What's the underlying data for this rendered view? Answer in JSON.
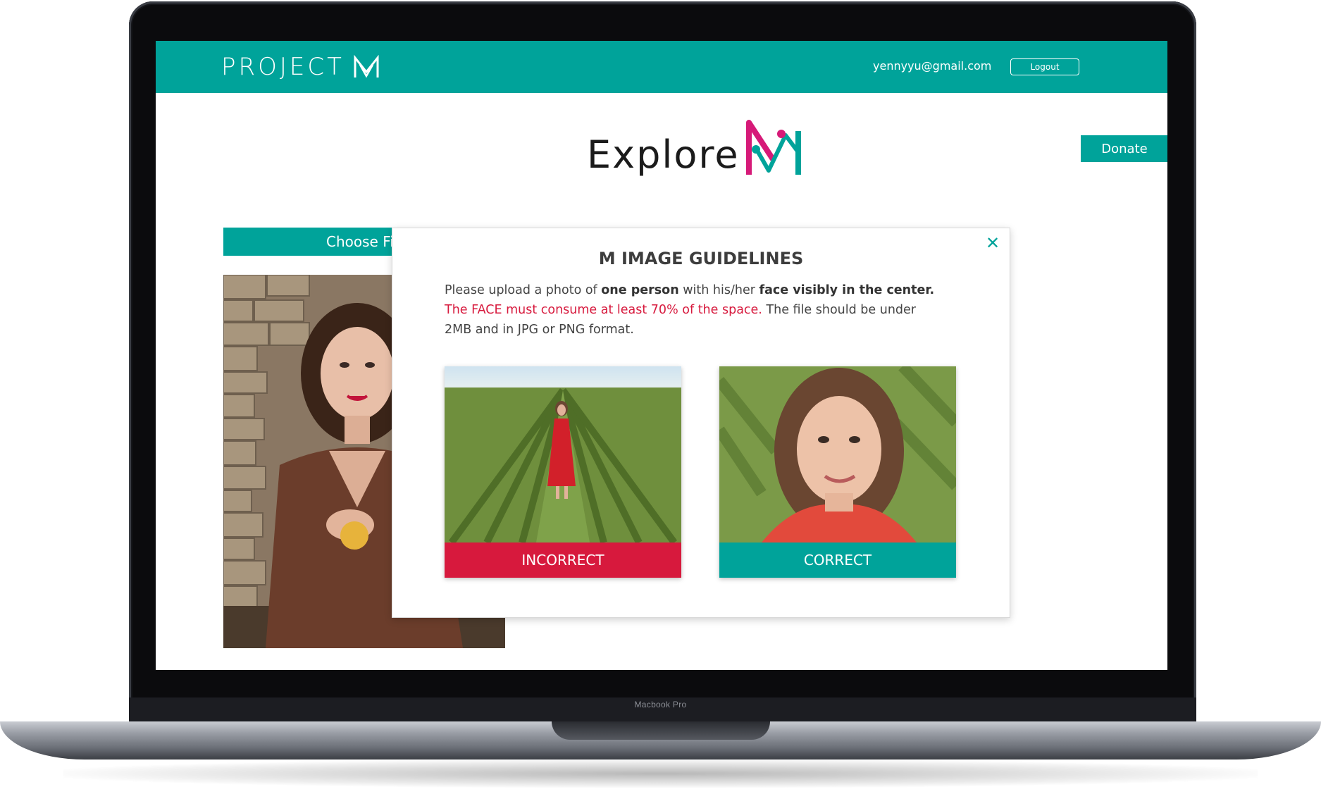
{
  "device": {
    "model_label": "Macbook Pro"
  },
  "header": {
    "logo_text": "PROJECT",
    "user_email": "yennyyu@gmail.com",
    "logout_label": "Logout"
  },
  "page": {
    "title": "Explore",
    "donate_label": "Donate",
    "choose_file_label": "Choose Fi"
  },
  "modal": {
    "title": "M IMAGE GUIDELINES",
    "close_icon": "close-icon",
    "text": {
      "part1": "Please upload a photo of ",
      "bold1": "one person",
      "part2": " with his/her ",
      "bold2": "face visibly in the center.",
      "red": "The FACE must consume at least 70% of the space.",
      "part3": " The file should be under 2MB and in JPG or PNG format."
    },
    "examples": [
      {
        "label": "INCORRECT"
      },
      {
        "label": "CORRECT"
      }
    ]
  },
  "colors": {
    "brand_teal": "#00a39a",
    "accent_magenta": "#d61a78",
    "error_red": "#d7193d"
  }
}
